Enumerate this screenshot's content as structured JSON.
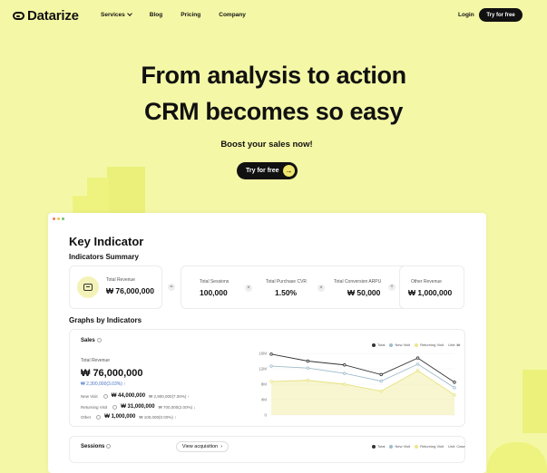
{
  "nav": {
    "logo": "Datarize",
    "links": [
      "Services",
      "Blog",
      "Pricing",
      "Company"
    ],
    "login": "Login",
    "cta": "Try for free"
  },
  "hero": {
    "title_line1": "From analysis to action",
    "title_line2": "CRM becomes so easy",
    "subtitle": "Boost your sales now!",
    "cta": "Try for free"
  },
  "dashboard": {
    "title": "Key Indicator",
    "summary_title": "Indicators Summary",
    "total_revenue": {
      "label": "Total Revenue",
      "value": "₩ 76,000,000"
    },
    "operators": [
      "=",
      "×",
      "×",
      "+"
    ],
    "metrics": [
      {
        "label": "Total Sessions",
        "value": "100,000"
      },
      {
        "label": "Total Purchase CVR",
        "value": "1.50%"
      },
      {
        "label": "Total Conversion ARPU",
        "value": "₩ 50,000"
      },
      {
        "label": "Other Revenue",
        "value": "₩ 1,000,000"
      }
    ],
    "graphs_title": "Graphs by Indicators",
    "sales": {
      "title": "Sales",
      "total_label": "Total Revenue",
      "total_value": "₩ 76,000,000",
      "change": "₩ 2,300,000(3.03%) ↑",
      "breakdown": [
        {
          "label": "New Visit",
          "value": "₩ 44,000,000",
          "change": "₩ 2,900,000(7.00%) ↑"
        },
        {
          "label": "Returning Visit",
          "value": "₩ 31,000,000",
          "change": "₩ 700,000(2.00%) ↓"
        },
        {
          "label": "Other",
          "value": "₩ 1,000,000",
          "change": "₩ 100,000(0.00%) ↑"
        }
      ],
      "legend": [
        "Total",
        "New Visit",
        "Returning Visit",
        "Unit: ₩"
      ],
      "colors": {
        "total": "#333333",
        "new": "#9fbccb",
        "returning": "#eae68a"
      }
    },
    "sessions": {
      "title": "Sessions",
      "view_button": "View acquisition",
      "legend": [
        "Total",
        "New Visit",
        "Returning Visit",
        "Unit: Case"
      ]
    }
  },
  "chart_data": {
    "type": "line",
    "categories": [
      "1",
      "2",
      "3",
      "4",
      "5",
      "6",
      "7"
    ],
    "ylim": [
      0,
      16000000
    ],
    "ytick_labels": [
      "16M",
      "12M",
      "8M",
      "4M",
      "0"
    ],
    "series": [
      {
        "name": "Total",
        "values": [
          15800000,
          14000000,
          13000000,
          10500000,
          14800000,
          8500000
        ]
      },
      {
        "name": "New Visit",
        "values": [
          12700000,
          12200000,
          10800000,
          8800000,
          13200000,
          7100000
        ]
      },
      {
        "name": "Returning Visit",
        "values": [
          8700000,
          9000000,
          8000000,
          6200000,
          11500000,
          5200000
        ]
      }
    ]
  }
}
